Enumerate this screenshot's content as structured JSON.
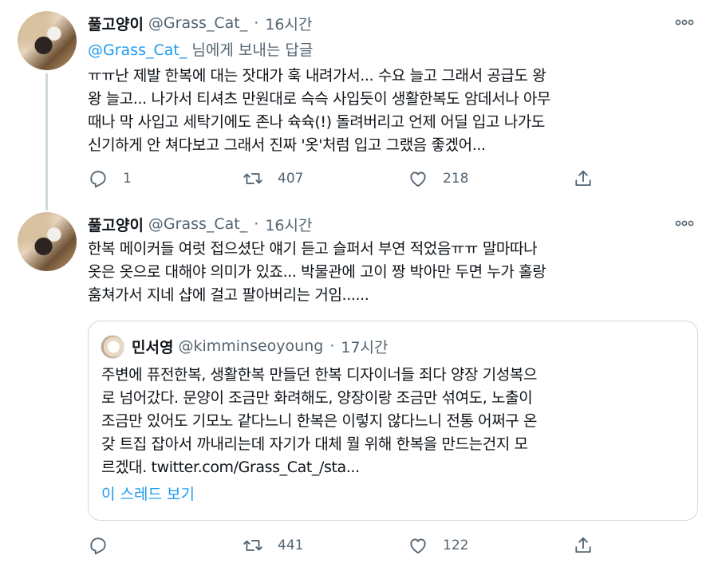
{
  "tweet1": {
    "name": "풀고양이",
    "handle": "@Grass_Cat_",
    "separator": "·",
    "time": "16시간",
    "more": "ooo",
    "reply_prefix": "@Grass_Cat_",
    "reply_suffix": " 님에게 보내는 답글",
    "lines": [
      "ㅠㅠ난 제발 한복에 대는 잣대가 훅 내려가서... 수요 늘고 그래서 공급도 왕",
      "왕 늘고... 나가서 티셔츠 만원대로 슥슥 사입듯이 생활한복도 암데서나 아무",
      "때나 막 사입고 세탁기에도 존나 슉슉(!) 돌려버리고 언제 어딜 입고 나가도",
      "신기하게 안 쳐다보고 그래서 진짜 '옷'처럼 입고 그랬음 좋겠어..."
    ],
    "replies": "1",
    "retweets": "407",
    "likes": "218"
  },
  "tweet2": {
    "name": "풀고양이",
    "handle": "@Grass_Cat_",
    "separator": "·",
    "time": "16시간",
    "more": "ooo",
    "lines": [
      "한복 메이커들 여럿 접으셨단 얘기 듣고 슬퍼서 부연 적었음ㅠㅠ 말마따나",
      "옷은 옷으로 대해야 의미가 있죠... 박물관에 고이 짱 박아만 두면 누가 홀랑",
      "훔쳐가서 지네 샵에 걸고 팔아버리는 거임......"
    ],
    "quote": {
      "name": "민서영",
      "handle": "@kimminseoyoung",
      "separator": "·",
      "time": "17시간",
      "lines": [
        "주변에 퓨전한복, 생활한복 만들던 한복 디자이너들 죄다 양장 기성복으",
        "로 넘어갔다. 문양이 조금만 화려해도, 양장이랑 조금만 섞여도, 노출이",
        "조금만 있어도 기모노 같다느니 한복은 이렇지 않다느니 전통 어쩌구 온",
        "갖 트집 잡아서 까내리는데 자기가 대체 뭘 위해 한복을 만드는건지 모",
        "르겠대. twitter.com/Grass_Cat_/sta..."
      ],
      "show_thread": "이 스레드 보기"
    },
    "replies": "",
    "retweets": "441",
    "likes": "122"
  },
  "icons": {
    "reply": "reply-icon",
    "retweet": "retweet-icon",
    "like": "like-icon",
    "share": "share-icon",
    "more": "more-icon"
  },
  "colors": {
    "link": "#1d9bf0",
    "muted": "#536471",
    "text": "#0f1419",
    "border": "#cfd9de"
  }
}
